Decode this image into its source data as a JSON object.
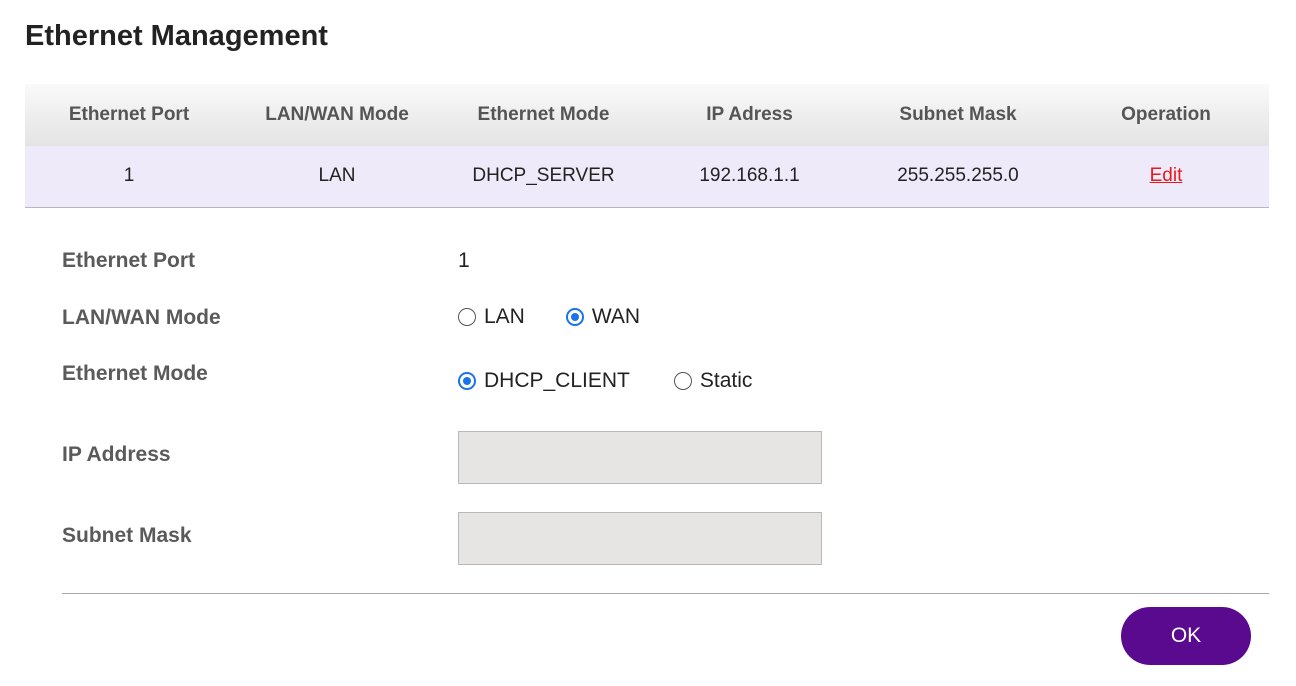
{
  "page": {
    "title": "Ethernet Management"
  },
  "table": {
    "headers": [
      "Ethernet Port",
      "LAN/WAN Mode",
      "Ethernet Mode",
      "IP Adress",
      "Subnet Mask",
      "Operation"
    ],
    "rows": [
      {
        "port": "1",
        "lan_wan_mode": "LAN",
        "ethernet_mode": "DHCP_SERVER",
        "ip_address": "192.168.1.1",
        "subnet_mask": "255.255.255.0",
        "operation": "Edit"
      }
    ]
  },
  "form": {
    "ethernet_port": {
      "label": "Ethernet Port",
      "value": "1"
    },
    "lan_wan_mode": {
      "label": "LAN/WAN Mode",
      "options": [
        "LAN",
        "WAN"
      ],
      "selected": "WAN"
    },
    "ethernet_mode": {
      "label": "Ethernet Mode",
      "options": [
        "DHCP_CLIENT",
        "Static"
      ],
      "selected": "DHCP_CLIENT"
    },
    "ip_address": {
      "label": "IP Address",
      "value": ""
    },
    "subnet_mask": {
      "label": "Subnet Mask",
      "value": ""
    }
  },
  "actions": {
    "ok_label": "OK"
  },
  "colors": {
    "ok_button": "#5a0a8e",
    "edit_link": "#e8191b",
    "radio_selected": "#1a73e8",
    "row_highlight": "#eeeafa"
  }
}
